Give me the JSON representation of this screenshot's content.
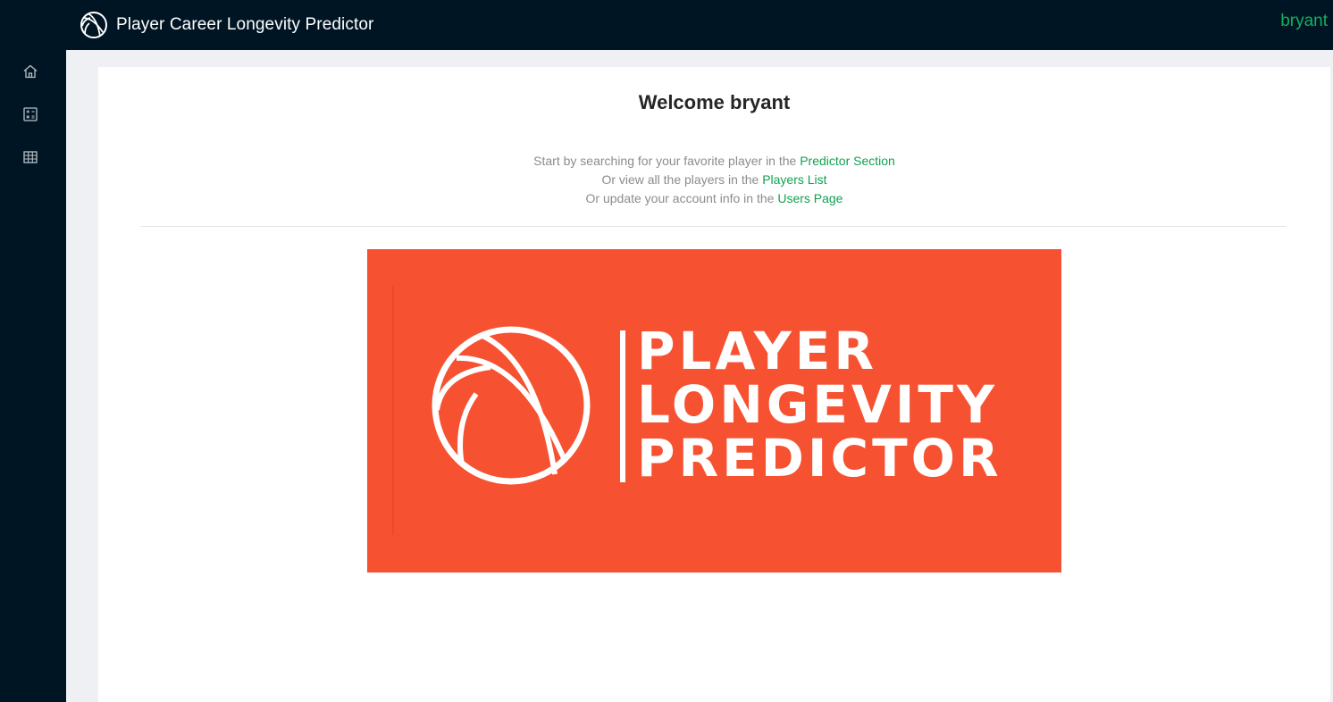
{
  "header": {
    "title": "Player Career Longevity Predictor",
    "user": "bryant",
    "logo_icon": "basketball-icon"
  },
  "sidebar": {
    "items": [
      {
        "icon": "home-icon"
      },
      {
        "icon": "calculator-icon"
      },
      {
        "icon": "table-icon"
      }
    ]
  },
  "main": {
    "welcome": "Welcome bryant",
    "lines": [
      {
        "prefix": "Start by searching for your favorite player in the ",
        "link": "Predictor Section"
      },
      {
        "prefix": "Or view all the players in the ",
        "link": "Players List"
      },
      {
        "prefix": "Or update your account info in the ",
        "link": "Users Page"
      }
    ]
  },
  "banner": {
    "line1": "PLAYER",
    "line2": "LONGEVITY",
    "line3": "PREDICTOR",
    "background": "#f65231",
    "icon": "basketball-icon"
  },
  "colors": {
    "header_bg": "#001524",
    "accent": "#12b05c",
    "page_bg": "#eef0f4"
  }
}
